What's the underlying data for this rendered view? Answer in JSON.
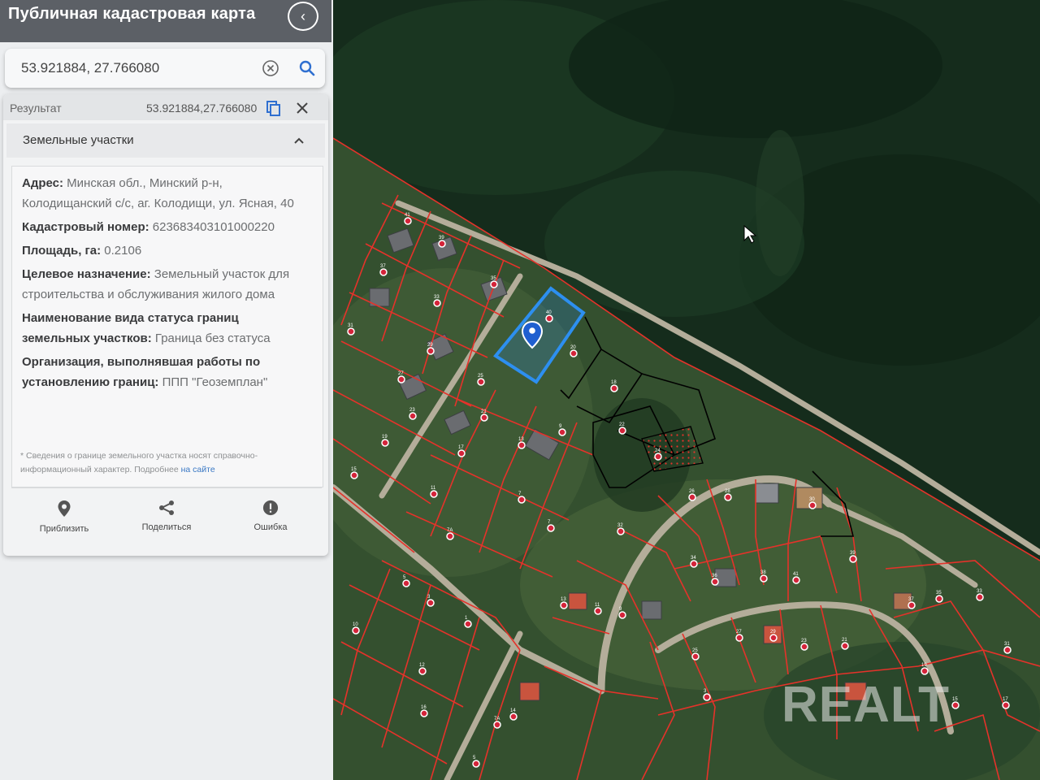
{
  "app": {
    "title": "Публичная кадастровая карта"
  },
  "search": {
    "value": "53.921884, 27.766080"
  },
  "result": {
    "label": "Результат",
    "coords": "53.921884,27.766080"
  },
  "section": {
    "title": "Земельные участки"
  },
  "parcel": {
    "address_label": "Адрес:",
    "address_value": "Минская обл., Минский р-н, Колодищанский с/с, аг. Колодищи, ул. Ясная, 40",
    "cadastral_label": "Кадастровый номер:",
    "cadastral_value": "623683403101000220",
    "area_label": "Площадь, га:",
    "area_value": "0.2106",
    "purpose_label": "Целевое назначение:",
    "purpose_value": "Земельный участок для строительства и обслуживания жилого дома",
    "status_label": "Наименование вида статуса границ земельных участков:",
    "status_value": "Граница без статуса",
    "org_label": "Организация, выполнявшая работы по установлению границ:",
    "org_value": "ППП \"Геоземплан\""
  },
  "note": {
    "text": "* Сведения о границе земельного участка носят справочно-информационный характер. Подробнее ",
    "link": "на сайте"
  },
  "actions": {
    "zoom": "Приблизить",
    "share": "Поделиться",
    "error": "Ошибка"
  },
  "map": {
    "selected_parcel_label": "40",
    "plot_labels": [
      "41",
      "39",
      "37",
      "35",
      "33",
      "31",
      "29",
      "27",
      "25",
      "23",
      "21",
      "19",
      "17",
      "15",
      "13",
      "11",
      "9",
      "7",
      "7А",
      "5",
      "3",
      "1",
      "10",
      "12",
      "14",
      "16",
      "18",
      "20",
      "22",
      "24",
      "26",
      "28",
      "30",
      "32",
      "34",
      "36",
      "38"
    ],
    "watermark": "REALT",
    "colors": {
      "forest": "#14301c",
      "clearing": "#3d5a33",
      "boundary": "#e5322a",
      "selected": "#2d8ff0",
      "road": "#b4ad9a"
    }
  }
}
